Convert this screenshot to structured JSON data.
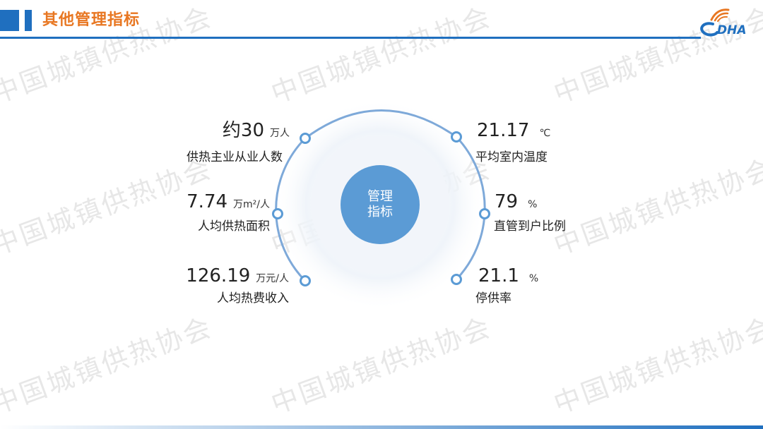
{
  "header": {
    "title": "其他管理指标",
    "logo_text": "DHA"
  },
  "watermark": "中国城镇供热协会",
  "center": {
    "line1": "管理",
    "line2": "指标"
  },
  "metrics": [
    {
      "value": "约30",
      "unit": "万人",
      "label": "供热主业从业人数"
    },
    {
      "value": "7.74",
      "unit": "万m²/人",
      "label": "人均供热面积"
    },
    {
      "value": "126.19",
      "unit": "万元/人",
      "label": "人均热费收入"
    },
    {
      "value": "21.17",
      "unit": "℃",
      "label": "平均室内温度"
    },
    {
      "value": "79",
      "unit": "%",
      "label": "直管到户比例"
    },
    {
      "value": "21.1",
      "unit": "%",
      "label": "停供率"
    }
  ],
  "colors": {
    "accent": "#1f6fbf",
    "title": "#e87722",
    "ring": "#7ea9d9",
    "center": "#5b9bd5"
  }
}
